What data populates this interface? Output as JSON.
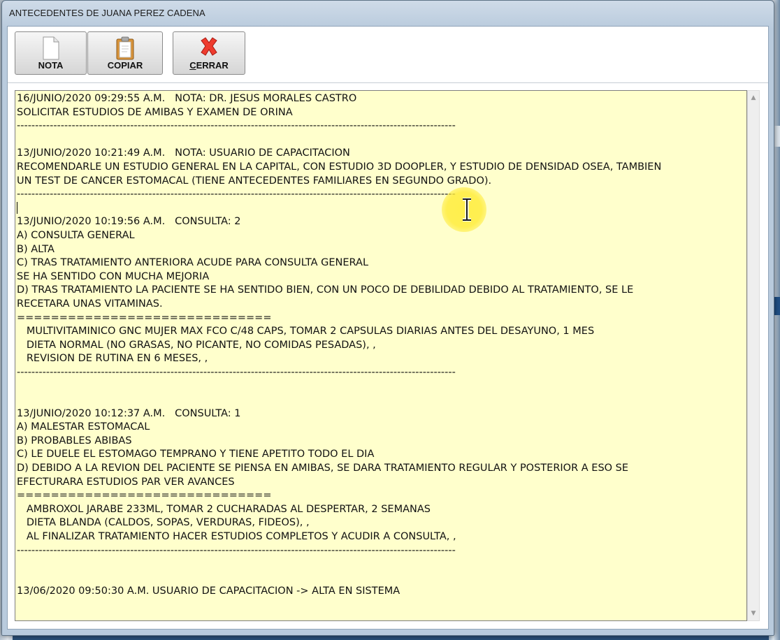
{
  "window": {
    "title": "ANTECEDENTES DE JUANA PEREZ CADENA"
  },
  "toolbar": {
    "nota_label": "NOTA",
    "copiar_label": "COPIAR",
    "cerrar_label": "CERRAR",
    "icons": {
      "nota": "document-icon",
      "copiar": "clipboard-icon",
      "cerrar": "close-x-icon"
    }
  },
  "notes": {
    "background_color": "#ffffcc",
    "lines": [
      "16/JUNIO/2020 09:29:55 A.M.   NOTA: DR. JESUS MORALES CASTRO",
      "SOLICITAR ESTUDIOS DE AMIBAS Y EXAMEN DE ORINA",
      "------------------------------------------------------------------------------------------------------------------------",
      "",
      "13/JUNIO/2020 10:21:49 A.M.   NOTA: USUARIO DE CAPACITACION",
      "RECOMENDARLE UN ESTUDIO GENERAL EN LA CAPITAL, CON ESTUDIO 3D DOOPLER, Y ESTUDIO DE DENSIDAD OSEA, TAMBIEN",
      "UN TEST DE CANCER ESTOMACAL (TIENE ANTECEDENTES FAMILIARES EN SEGUNDO GRADO).",
      "------------------------------------------------------------------------------------------------------------------------",
      "",
      "13/JUNIO/2020 10:19:56 A.M.   CONSULTA: 2",
      "A) CONSULTA GENERAL",
      "B) ALTA",
      "C) TRAS TRATAMIENTO ANTERIORA ACUDE PARA CONSULTA GENERAL",
      "SE HA SENTIDO CON MUCHA MEJORIA",
      "D) TRAS TRATAMIENTO LA PACIENTE SE HA SENTIDO BIEN, CON UN POCO DE DEBILIDAD DEBIDO AL TRATAMIENTO, SE LE",
      "RECETARA UNAS VITAMINAS.",
      "==============================",
      "   MULTIVITAMINICO GNC MUJER MAX FCO C/48 CAPS, TOMAR 2 CAPSULAS DIARIAS ANTES DEL DESAYUNO, 1 MES",
      "   DIETA NORMAL (NO GRASAS, NO PICANTE, NO COMIDAS PESADAS), ,",
      "   REVISION DE RUTINA EN 6 MESES, ,",
      "------------------------------------------------------------------------------------------------------------------------",
      "",
      "",
      "13/JUNIO/2020 10:12:37 A.M.   CONSULTA: 1",
      "A) MALESTAR ESTOMACAL",
      "B) PROBABLES ABIBAS",
      "C) LE DUELE EL ESTOMAGO TEMPRANO Y TIENE APETITO TODO EL DIA",
      "D) DEBIDO A LA REVION DEL PACIENTE SE PIENSA EN AMIBAS, SE DARA TRATAMIENTO REGULAR Y POSTERIOR A ESO SE",
      "EFECTURARA ESTUDIOS PAR VER AVANCES",
      "==============================",
      "   AMBROXOL JARABE 233ML, TOMAR 2 CUCHARADAS AL DESPERTAR, 2 SEMANAS",
      "   DIETA BLANDA (CALDOS, SOPAS, VERDURAS, FIDEOS), ,",
      "   AL FINALIZAR TRATAMIENTO HACER ESTUDIOS COMPLETOS Y ACUDIR A CONSULTA, ,",
      "------------------------------------------------------------------------------------------------------------------------",
      "",
      "",
      "13/06/2020 09:50:30 A.M. USUARIO DE CAPACITACION -> ALTA EN SISTEMA"
    ]
  },
  "scrollbar": {
    "up_icon": "scroll-up-arrow-icon",
    "down_icon": "scroll-down-arrow-icon"
  }
}
